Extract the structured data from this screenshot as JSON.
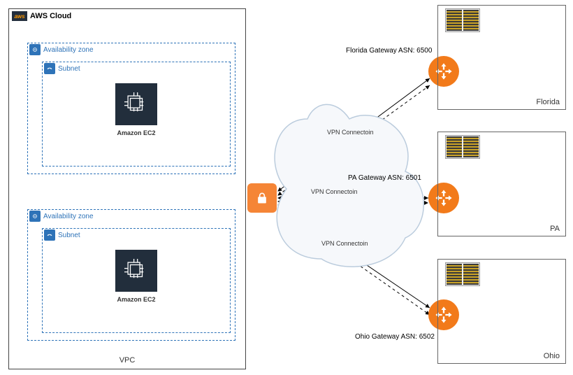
{
  "aws": {
    "cloud_label": "AWS Cloud",
    "vpc_label": "VPC",
    "az_label": "Availability zone",
    "subnet_label": "Subnet",
    "ec2_label": "Amazon EC2"
  },
  "vpn": {
    "fl_conn": "VPN Connectoin",
    "pa_conn": "VPN Connectoin",
    "oh_conn": "VPN Connectoin"
  },
  "gateways": {
    "fl": "Florida Gateway ASN: 6500",
    "pa": "PA Gateway ASN: 6501",
    "oh": "Ohio Gateway ASN: 6502"
  },
  "sites": {
    "fl": "Florida",
    "pa": "PA",
    "oh": "Ohio"
  }
}
